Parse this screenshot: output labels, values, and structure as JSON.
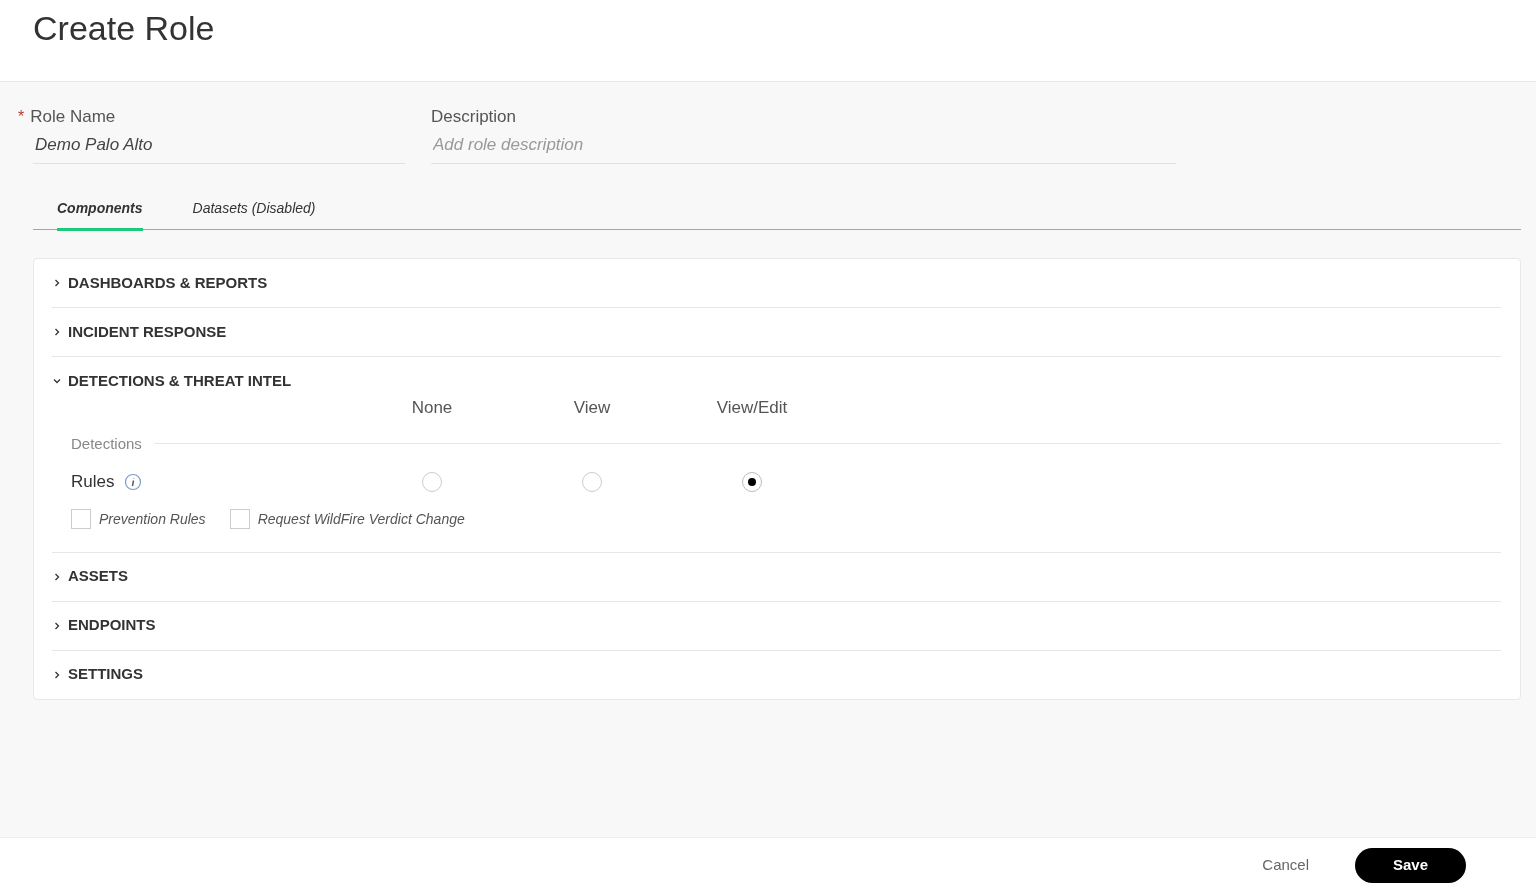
{
  "title": "Create Role",
  "fields": [
    {
      "label": "Role Name",
      "required_mark": "*",
      "value": "Demo Palo Alto"
    },
    {
      "label": "Description",
      "placeholder": "Add role description"
    }
  ],
  "tabs": [
    {
      "label": "Components",
      "selected": true
    },
    {
      "label": "Datasets (Disabled)",
      "selected": false
    }
  ],
  "sections": [
    {
      "title": "DASHBOARDS & REPORTS",
      "expanded": false
    },
    {
      "title": "INCIDENT RESPONSE",
      "expanded": false
    },
    {
      "title": "DETECTIONS & THREAT INTEL",
      "expanded": true,
      "columns": [
        "None",
        "View",
        "View/Edit"
      ],
      "groups": [
        {
          "label": "Detections",
          "rows": [
            {
              "label": "Rules",
              "info": true,
              "options": [
                {
                  "selected": false
                },
                {
                  "selected": false
                },
                {
                  "selected": true
                }
              ],
              "checkboxes": [
                {
                  "label": "Prevention Rules",
                  "checked": false
                },
                {
                  "label": "Request WildFire Verdict Change",
                  "checked": false
                }
              ]
            }
          ]
        }
      ]
    },
    {
      "title": "ASSETS",
      "expanded": false
    },
    {
      "title": "ENDPOINTS",
      "expanded": false
    },
    {
      "title": "SETTINGS",
      "expanded": false
    }
  ],
  "buttons": {
    "cancel": "Cancel",
    "save": "Save"
  }
}
